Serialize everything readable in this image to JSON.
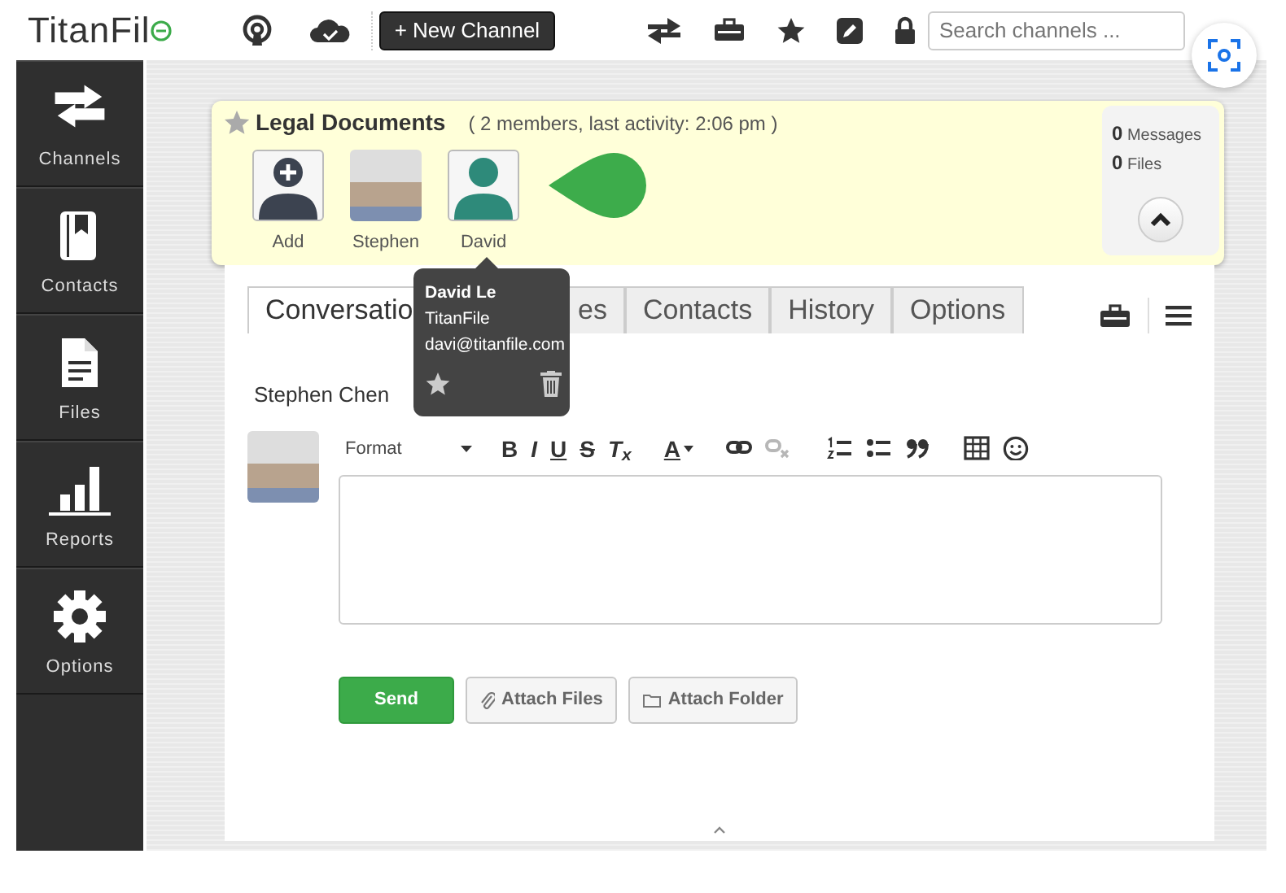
{
  "header": {
    "logo": "TitanFil",
    "new_channel": "+ New Channel",
    "search": {
      "placeholder": "Search channels ..."
    }
  },
  "sidebar": {
    "items": [
      {
        "label": "Channels",
        "kind": "channels"
      },
      {
        "label": "Contacts",
        "kind": "contacts"
      },
      {
        "label": "Files",
        "kind": "files"
      },
      {
        "label": "Reports",
        "kind": "reports"
      },
      {
        "label": "Options",
        "kind": "options"
      }
    ]
  },
  "channel": {
    "title": "Legal Documents",
    "starred": false,
    "meta": "( 2 members, last activity: 2:06 pm )",
    "members": [
      {
        "name": "Add",
        "kind": "add"
      },
      {
        "name": "Stephen",
        "kind": "photo"
      },
      {
        "name": "David",
        "kind": "silhouette"
      }
    ],
    "stats": [
      "**0** Messages",
      "**0** Files"
    ]
  },
  "tooltip": {
    "name": "David Le",
    "company": "TitanFile",
    "email": "davi@titanfile.com"
  },
  "tabs": [
    {
      "label": "Conversatio",
      "selected": true
    },
    {
      "label": "es",
      "selected": false
    },
    {
      "label": "Contacts",
      "selected": false
    },
    {
      "label": "History",
      "selected": false
    },
    {
      "label": "Options",
      "selected": false
    }
  ],
  "composer": {
    "author": "Stephen Chen",
    "format": "Format",
    "toolbar": [
      {
        "kind": "bold",
        "label": "B",
        "disabled": false
      },
      {
        "kind": "italic",
        "label": "I",
        "disabled": false
      },
      {
        "kind": "underline",
        "label": "U",
        "disabled": false
      },
      {
        "kind": "strike",
        "label": "S",
        "disabled": false
      },
      {
        "kind": "clear",
        "label": "T$_{x}$",
        "disabled": false
      },
      {
        "kind": "color",
        "label": "A",
        "disabled": false
      },
      {
        "kind": "link",
        "disabled": false
      },
      {
        "kind": "unlink",
        "disabled": true
      },
      {
        "kind": "ol",
        "disabled": false
      },
      {
        "kind": "ul",
        "disabled": false
      },
      {
        "kind": "quote",
        "disabled": false
      },
      {
        "kind": "table",
        "disabled": false
      },
      {
        "kind": "emoji",
        "disabled": false
      }
    ],
    "buttons": [
      {
        "label": "Send",
        "kind": "primary"
      },
      {
        "label": "Attach Files",
        "kind": "files"
      },
      {
        "label": "Attach Folder",
        "kind": "folder"
      }
    ]
  }
}
